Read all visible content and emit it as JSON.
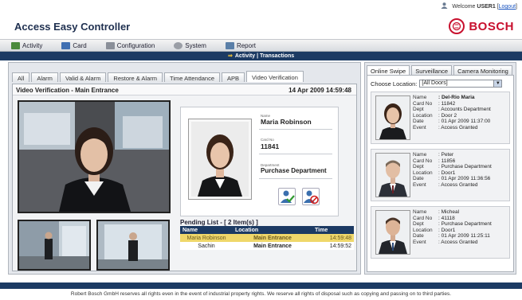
{
  "topbar": {
    "welcome": "Welcome",
    "user": "USER1",
    "logout": "Logout"
  },
  "header": {
    "title": "Access Easy Controller",
    "brand": "BOSCH"
  },
  "menu": [
    {
      "label": "Activity"
    },
    {
      "label": "Card"
    },
    {
      "label": "Configuration"
    },
    {
      "label": "System"
    },
    {
      "label": "Report"
    }
  ],
  "breadcrumb": "Activity | Transactions",
  "tabs": [
    "All",
    "Alarm",
    "Valid & Alarm",
    "Restore & Alarm",
    "Time Attendance",
    "APB",
    "Video Verification"
  ],
  "panel": {
    "title": "Video Verification - Main Entrance",
    "timestamp": "14 Apr 2009 14:59:48"
  },
  "card": {
    "name_label": "Name",
    "name": "Maria Robinson",
    "cardno_label": "Card No",
    "cardno": "11841",
    "dept_label": "Department",
    "dept": "Purchase Department"
  },
  "pending": {
    "title": "Pending List - [ 2 Item(s) ]",
    "headers": [
      "Name",
      "Location",
      "Time"
    ],
    "rows": [
      {
        "name": "Maria Robinson",
        "location": "Main Entrance",
        "time": "14:59:48"
      },
      {
        "name": "Sachin",
        "location": "Main Entrance",
        "time": "14:59:52"
      }
    ]
  },
  "side_tabs": [
    "Online Swipe",
    "Surveillance",
    "Camera Monitoring"
  ],
  "choose_location": {
    "label": "Choose Location:",
    "value": "[All Doors]"
  },
  "event_labels": {
    "name": "Name",
    "cardno": "Card No",
    "dept": "Dept",
    "location": "Location",
    "date": "Date",
    "event": "Event"
  },
  "events": [
    {
      "name": ": Del-Rio Maria",
      "cardno": ": 11842",
      "dept": ": Accounts Department",
      "location": ": Door 2",
      "date": ": 01 Apr 2009 11:37:00",
      "event": ": Access Granted"
    },
    {
      "name": ": Peter",
      "cardno": ": 11856",
      "dept": ": Purchase Department",
      "location": ": Door1",
      "date": ": 01 Apr 2009 11:36:56",
      "event": ": Access Granted"
    },
    {
      "name": ": Micheal",
      "cardno": ": 41118",
      "dept": ": Purchase Department",
      "location": ": Door1",
      "date": ": 01 Apr 2009 11:25:11",
      "event": ": Access Granted"
    }
  ],
  "footer": "Robert Bosch GmbH reserves all rights even in the event of industrial property rights. We reserve all rights of disposal such as copying and passing on to third parties.",
  "colors": {
    "nav_dark": "#1c3a63",
    "brand_red": "#c8102e",
    "pending_highlight": "#efd76a"
  }
}
